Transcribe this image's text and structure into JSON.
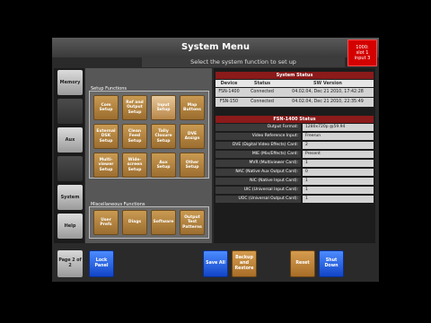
{
  "window": {
    "title": "System Menu",
    "subtitle": "Select the system function to set up"
  },
  "alert": {
    "lines": [
      "1000:",
      "slot 1",
      "input 3"
    ]
  },
  "sidebar": {
    "items": [
      {
        "label": "Memory"
      },
      {
        "label": "Aux"
      },
      {
        "label": "System"
      },
      {
        "label": "Help"
      }
    ]
  },
  "setup_functions": {
    "label": "Setup Functions",
    "tiles": [
      "Com Setup",
      "Ref and Output Setup",
      "Input Setup",
      "Map Buttons",
      "External DSK Setup",
      "Clean Feed Setup",
      "Tally Closure Setup",
      "DVE Assign",
      "Multi-viewer Setup",
      "Wide-screen Setup",
      "Aux Setup",
      "Other Setup"
    ]
  },
  "misc_functions": {
    "label": "Miscellaneous Functions",
    "tiles": [
      "User Prefs",
      "Diags",
      "Software",
      "Output Test Patterns"
    ]
  },
  "system_status": {
    "title": "System Status",
    "columns": [
      "Device",
      "Status",
      "SW Version"
    ],
    "rows": [
      [
        "FSN-1400",
        "Connected",
        "04.02.04, Dec 21 2010, 17:42:28"
      ],
      [
        "FSN-150",
        "Connected",
        "04.02.04, Dec 21 2010, 22:35:49"
      ]
    ]
  },
  "fsn_status": {
    "title": "FSN-1400 Status",
    "rows": [
      [
        "Output Format:",
        "1280x720p @59.94"
      ],
      [
        "Video Reference Input:",
        "Freerun"
      ],
      [
        "DVE (Digital Video Effects) Card:",
        "2"
      ],
      [
        "MIE (Mix/Effects) Card:",
        "Present"
      ],
      [
        "MVR (Multiviewer Card):",
        "1"
      ],
      [
        "NAC (Native Aux Output Card):",
        "0"
      ],
      [
        "NIC (Native Input Card):",
        "1"
      ],
      [
        "UIC (Universal Input Card):",
        "1"
      ],
      [
        "UOC (Universal Output Card):",
        "1"
      ]
    ]
  },
  "bottom_bar": {
    "page": "Page 2 of 2",
    "lock_panel": "Lock Panel",
    "save_all": "Save All",
    "backup_restore": "Backup and Restore",
    "reset": "Reset",
    "shut_down": "Shut Down"
  }
}
